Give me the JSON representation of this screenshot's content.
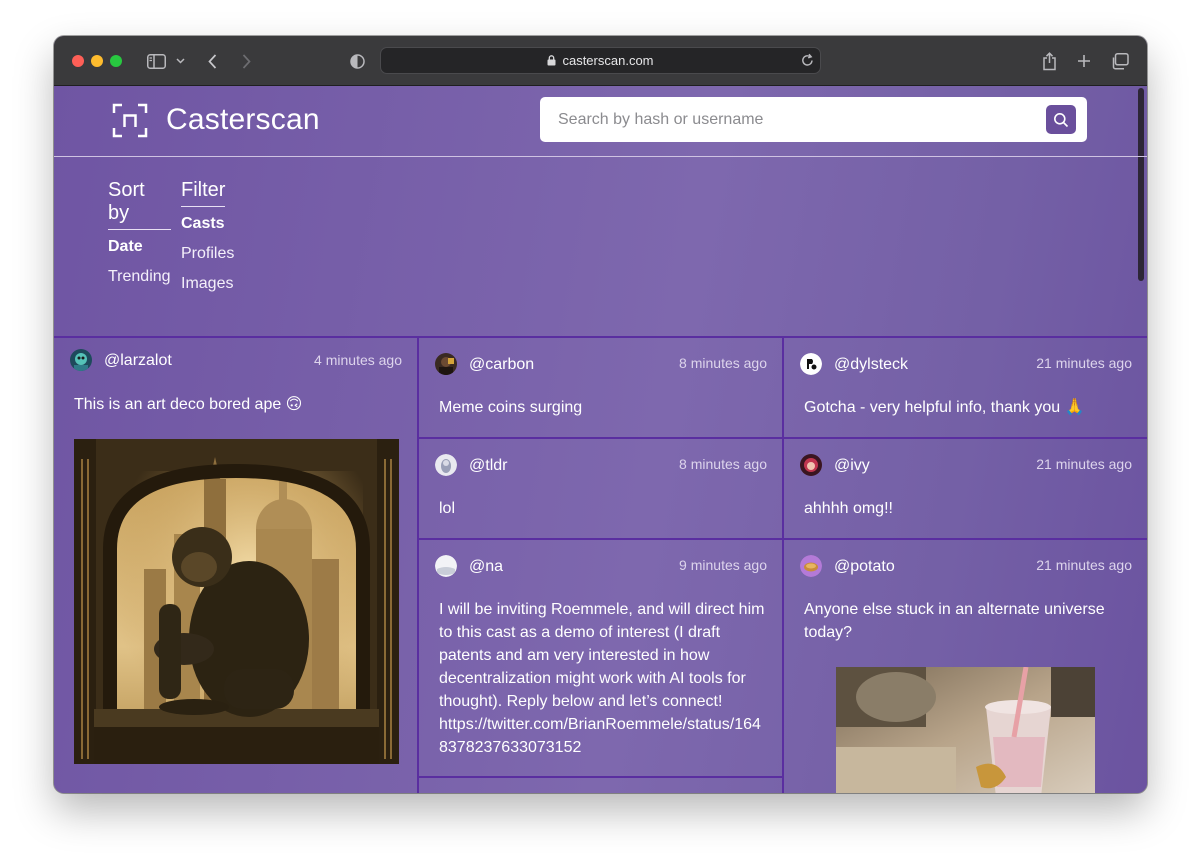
{
  "browser": {
    "url": "casterscan.com"
  },
  "site": {
    "brand": "Casterscan",
    "search_placeholder": "Search by hash or username"
  },
  "sort": {
    "heading": "Sort by",
    "options": [
      "Date",
      "Trending"
    ],
    "active": "Date"
  },
  "filter": {
    "heading": "Filter",
    "options": [
      "Casts",
      "Profiles",
      "Images"
    ],
    "active": "Casts"
  },
  "casts": [
    {
      "username": "@larzalot",
      "time": "4 minutes ago",
      "text": "This is an art deco bored ape 🙃",
      "has_image": true
    },
    {
      "username": "@carbon",
      "time": "8 minutes ago",
      "text": "Meme coins surging"
    },
    {
      "username": "@dylsteck",
      "time": "21 minutes ago",
      "text": "Gotcha - very helpful info, thank you 🙏"
    },
    {
      "username": "@tldr",
      "time": "8 minutes ago",
      "text": "lol"
    },
    {
      "username": "@ivy",
      "time": "21 minutes ago",
      "text": "ahhhh omg!!"
    },
    {
      "username": "@na",
      "time": "9 minutes ago",
      "text": "I will be inviting Roemmele, and will direct him to this cast as a demo of interest (I draft patents and am very interested in how decentralization might work with AI tools for thought). Reply below and let’s connect! https://twitter.com/BrianRoemmele/status/1648378237633073152"
    },
    {
      "username": "@potato",
      "time": "21 minutes ago",
      "text": "Anyone else stuck in an alternate universe today?",
      "has_image": true
    }
  ]
}
